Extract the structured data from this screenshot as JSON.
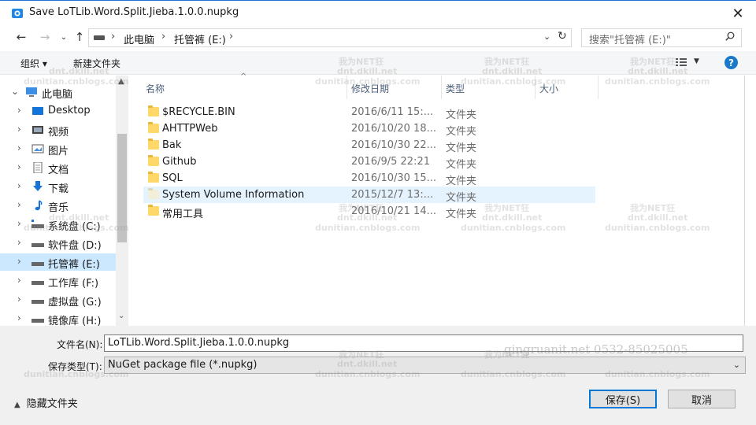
{
  "window": {
    "title": "Save LoTLib.Word.Split.Jieba.1.0.0.nupkg"
  },
  "address": {
    "crumbs": [
      "此电脑",
      "托管裤 (E:)"
    ],
    "separator": "›"
  },
  "search": {
    "placeholder": "搜索\"托管裤 (E:)\""
  },
  "toolbar": {
    "organize": "组织 ▾",
    "new_folder": "新建文件夹",
    "help": "?"
  },
  "sidebar": {
    "items": [
      {
        "label": "此电脑",
        "icon": "computer-icon",
        "expanded": true
      },
      {
        "label": "Desktop",
        "icon": "desktop-icon"
      },
      {
        "label": "视频",
        "icon": "video-icon"
      },
      {
        "label": "图片",
        "icon": "pictures-icon"
      },
      {
        "label": "文档",
        "icon": "documents-icon"
      },
      {
        "label": "下载",
        "icon": "download-icon"
      },
      {
        "label": "音乐",
        "icon": "music-icon"
      },
      {
        "label": "系统盘 (C:)",
        "icon": "system-drive-icon"
      },
      {
        "label": "软件盘 (D:)",
        "icon": "drive-icon"
      },
      {
        "label": "托管裤 (E:)",
        "icon": "drive-icon",
        "selected": true
      },
      {
        "label": "工作库 (F:)",
        "icon": "drive-icon"
      },
      {
        "label": "虚拟盘 (G:)",
        "icon": "drive-icon"
      },
      {
        "label": "镜像库 (H:)",
        "icon": "drive-icon"
      }
    ]
  },
  "columns": {
    "name": "名称",
    "modified": "修改日期",
    "type": "类型",
    "size": "大小"
  },
  "files": [
    {
      "name": "$RECYCLE.BIN",
      "modified": "2016/6/11 15:...",
      "type": "文件夹"
    },
    {
      "name": "AHTTPWeb",
      "modified": "2016/10/20 18...",
      "type": "文件夹"
    },
    {
      "name": "Bak",
      "modified": "2016/10/30 22...",
      "type": "文件夹"
    },
    {
      "name": "Github",
      "modified": "2016/9/5 22:21",
      "type": "文件夹"
    },
    {
      "name": "SQL",
      "modified": "2016/10/30 15...",
      "type": "文件夹"
    },
    {
      "name": "System Volume Information",
      "modified": "2015/12/7 13:...",
      "type": "文件夹",
      "hover": true
    },
    {
      "name": "常用工具",
      "modified": "2016/10/21 14...",
      "type": "文件夹"
    }
  ],
  "form": {
    "filename_label": "文件名(N):",
    "filename_value": "LoTLib.Word.Split.Jieba.1.0.0.nupkg",
    "filetype_label": "保存类型(T):",
    "filetype_value": "NuGet package file (*.nupkg)"
  },
  "footer": {
    "hide_folders": "隐藏文件夹",
    "save": "保存(S)",
    "cancel": "取消"
  },
  "watermark": {
    "line1": "我为NET狂",
    "line2": "dnt.dkill.net",
    "line3": "dunitian.cnblogs.com",
    "overlay": "qingruanit.net 0532-85025005"
  },
  "colors": {
    "selection": "#cce8ff",
    "hover": "#e5f3ff",
    "accent": "#0078d7",
    "folder": "#ffd869"
  }
}
